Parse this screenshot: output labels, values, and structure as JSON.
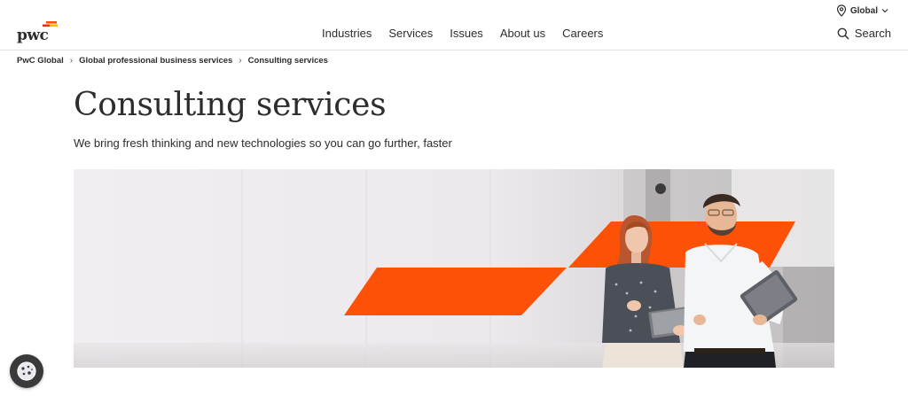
{
  "brand": {
    "name": "pwc",
    "accent": "#fd5108"
  },
  "header": {
    "region_label": "Global",
    "nav": [
      "Industries",
      "Services",
      "Issues",
      "About us",
      "Careers"
    ],
    "search_label": "Search"
  },
  "breadcrumb": {
    "items": [
      "PwC Global",
      "Global professional business services",
      "Consulting services"
    ]
  },
  "main": {
    "title": "Consulting services",
    "subtitle": "We bring fresh thinking and new technologies so you can go further, faster"
  },
  "icons": {
    "location": "location-pin-icon",
    "chevron": "chevron-down-icon",
    "search": "search-icon",
    "cookie": "cookie-icon"
  }
}
